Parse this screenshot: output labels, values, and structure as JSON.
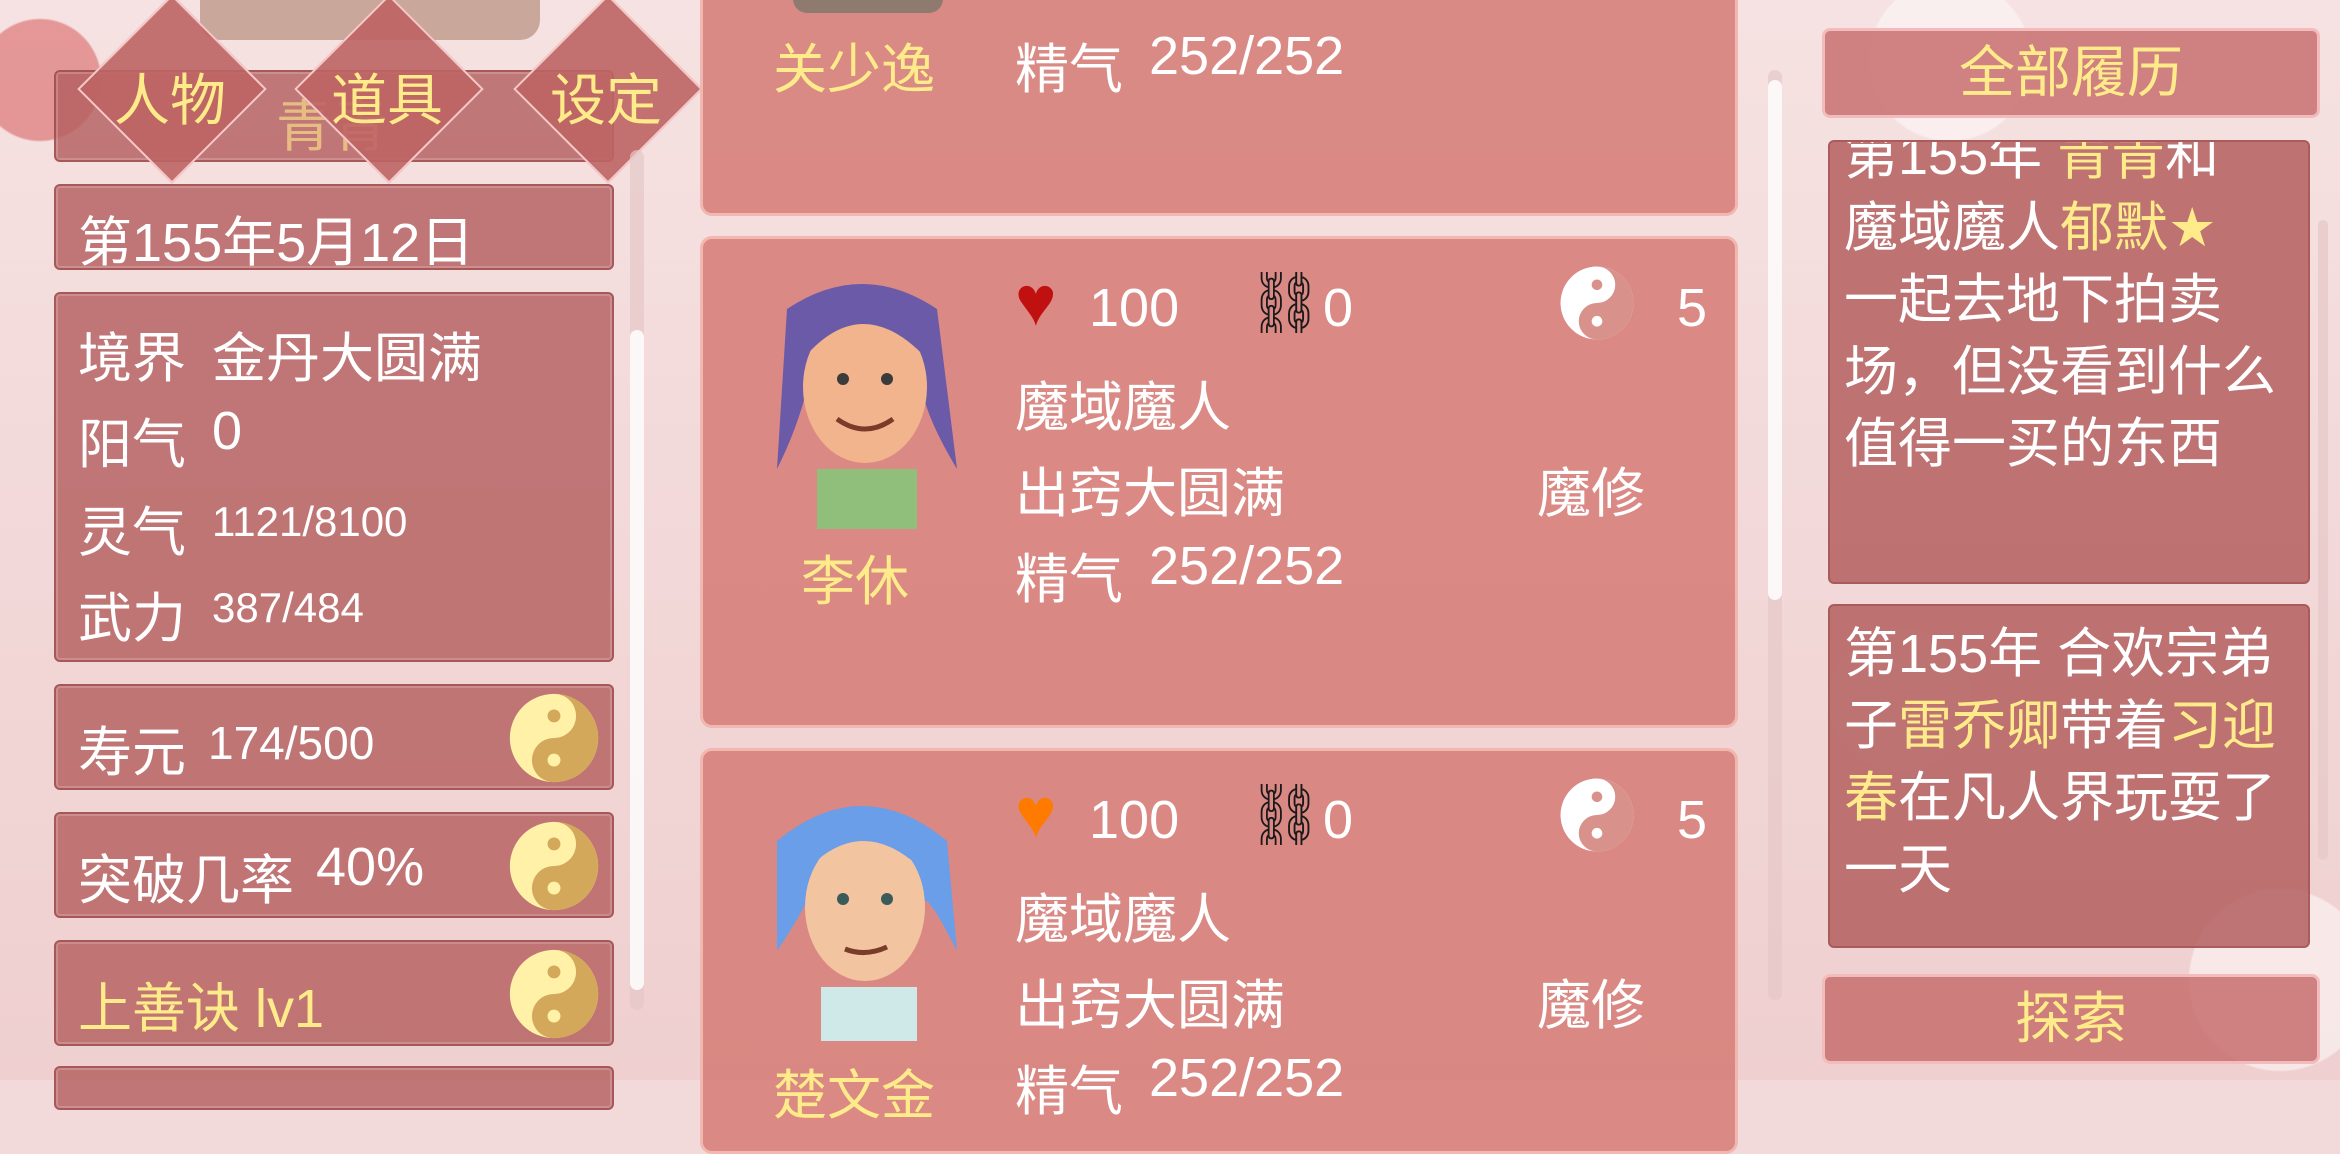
{
  "nav": {
    "tabs": [
      {
        "label": "人物"
      },
      {
        "label": "道具"
      },
      {
        "label": "设定"
      }
    ],
    "behind_label": "青青"
  },
  "left": {
    "date": "第155年5月12日",
    "stats": {
      "realm_label": "境界",
      "realm_value": "金丹大圆满",
      "yang_label": "阳气",
      "yang_value": "0",
      "spirit_label": "灵气",
      "spirit_value": "1121/8100",
      "force_label": "武力",
      "force_value": "387/484"
    },
    "lifespan_label": "寿元",
    "lifespan_value": "174/500",
    "breakthrough_label": "突破几率",
    "breakthrough_value": "40%",
    "skill_label": "上善诀 lv1"
  },
  "characters": [
    {
      "name": "关少逸",
      "energy_label": "精气",
      "energy_value": "252/252"
    },
    {
      "name": "李休",
      "heart": "100",
      "bond": "0",
      "yinyang": "5",
      "origin": "魔域魔人",
      "realm": "出窍大圆满",
      "path": "魔修",
      "energy_label": "精气",
      "energy_value": "252/252",
      "heart_color": "#c01010",
      "hair_color": "#6a5aa8"
    },
    {
      "name": "楚文金",
      "heart": "100",
      "bond": "0",
      "yinyang": "5",
      "origin": "魔域魔人",
      "realm": "出窍大圆满",
      "path": "魔修",
      "energy_label": "精气",
      "energy_value": "252/252",
      "heart_color": "#ff7a00",
      "hair_color": "#6a9ee8"
    }
  ],
  "right": {
    "history_button": "全部履历",
    "log1": {
      "l1a": "第155年 ",
      "l1b": "青青",
      "l1c": "和",
      "l2a": "魔域魔人",
      "l2b": "郁默★",
      "l3": "一起去地下拍卖场，但没看到什么值得一买的东西"
    },
    "log2": {
      "a": "第155年 合欢宗弟子",
      "b": "雷乔卿",
      "c": "带着",
      "d": "习迎春",
      "e": "在凡人界玩耍了一天"
    },
    "explore_button": "探索"
  },
  "colors": {
    "accent_gold": "#ffeb8a",
    "panel": "#b45f5f"
  }
}
